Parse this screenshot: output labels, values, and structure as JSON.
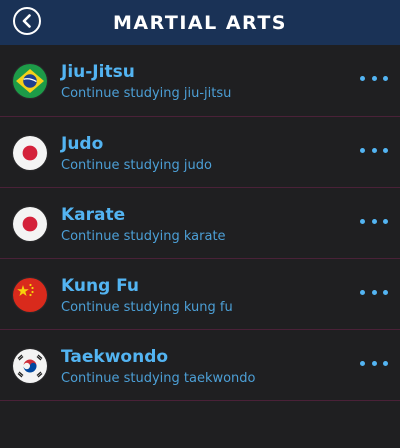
{
  "header": {
    "title": "MARTIAL ARTS",
    "back_icon": "chevron-left-icon",
    "background": "#1a3256"
  },
  "colors": {
    "accent": "#53b4f2",
    "row_divider": "#4a2138",
    "background": "#1f1f21"
  },
  "items": [
    {
      "title": "Jiu-Jitsu",
      "subtitle": "Continue studying jiu-jitsu",
      "icon": "brazil-flag-icon",
      "more_icon": "more-options-icon"
    },
    {
      "title": "Judo",
      "subtitle": "Continue studying judo",
      "icon": "japan-flag-icon",
      "more_icon": "more-options-icon"
    },
    {
      "title": "Karate",
      "subtitle": "Continue studying karate",
      "icon": "japan-flag-icon",
      "more_icon": "more-options-icon"
    },
    {
      "title": "Kung Fu",
      "subtitle": "Continue studying kung fu",
      "icon": "china-flag-icon",
      "more_icon": "more-options-icon"
    },
    {
      "title": "Taekwondo",
      "subtitle": "Continue studying taekwondo",
      "icon": "south-korea-flag-icon",
      "more_icon": "more-options-icon"
    }
  ]
}
